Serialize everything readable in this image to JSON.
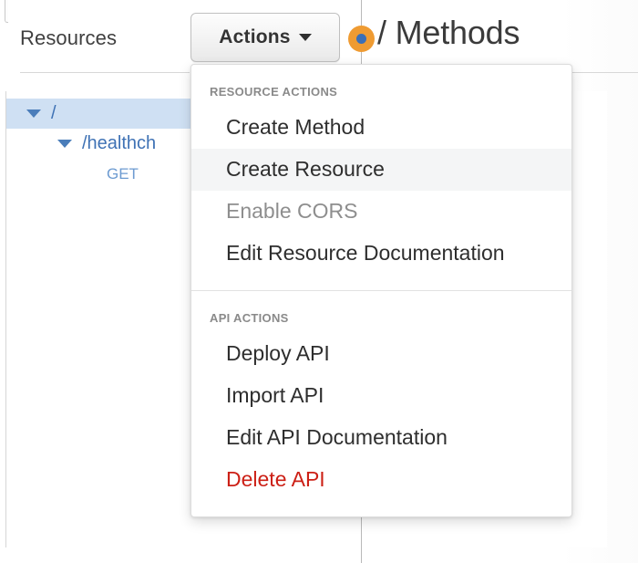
{
  "header": {
    "resources_title": "Resources",
    "actions_button_label": "Actions",
    "caret_icon": "chevron-down-icon",
    "page_title": "/ Methods",
    "node_dot_color": "#ef9b32",
    "node_dot_inner_color": "#3a6fb8"
  },
  "tree": {
    "items": [
      {
        "label": "/",
        "type": "resource",
        "selected": true,
        "expanded": true
      },
      {
        "label": "/healthch",
        "type": "resource",
        "selected": false,
        "expanded": true
      },
      {
        "label": "GET",
        "type": "method",
        "selected": false
      }
    ]
  },
  "dropdown": {
    "sections": [
      {
        "label": "RESOURCE ACTIONS",
        "items": [
          {
            "label": "Create Method",
            "state": "normal"
          },
          {
            "label": "Create Resource",
            "state": "hovered"
          },
          {
            "label": "Enable CORS",
            "state": "disabled"
          },
          {
            "label": "Edit Resource Documentation",
            "state": "normal"
          }
        ]
      },
      {
        "label": "API ACTIONS",
        "items": [
          {
            "label": "Deploy API",
            "state": "normal"
          },
          {
            "label": "Import API",
            "state": "normal"
          },
          {
            "label": "Edit API Documentation",
            "state": "normal"
          },
          {
            "label": "Delete API",
            "state": "danger"
          }
        ]
      }
    ]
  },
  "colors": {
    "link_blue": "#3f72b5",
    "selected_row": "#cfe0f3",
    "danger_red": "#cc2016",
    "disabled_grey": "#8e8e8e",
    "accent_orange": "#ef9b32"
  }
}
